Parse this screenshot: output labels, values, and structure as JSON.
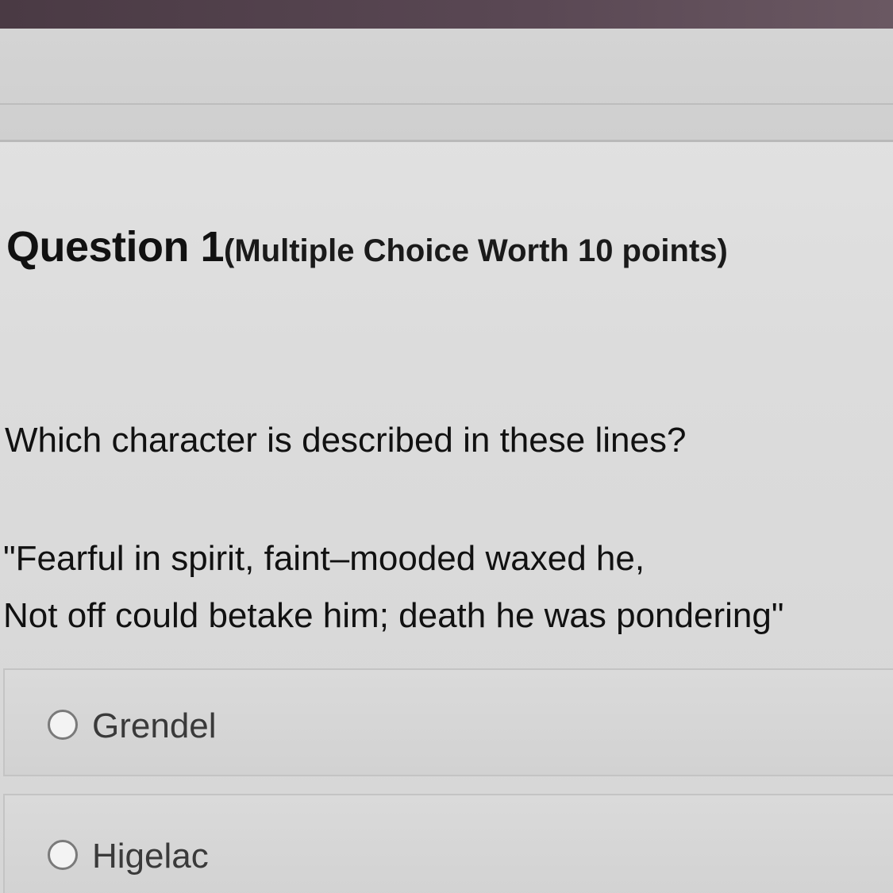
{
  "question": {
    "number_label": "Question 1",
    "meta": "(Multiple Choice Worth 10 points)",
    "prompt": "Which character is described in these lines?",
    "quote_lines": [
      "\"Fearful in spirit, faint–mooded waxed he,",
      "Not off could betake him; death he was pondering\""
    ]
  },
  "options": [
    {
      "label": "Grendel",
      "selected": false
    },
    {
      "label": "Higelac",
      "selected": false
    }
  ]
}
